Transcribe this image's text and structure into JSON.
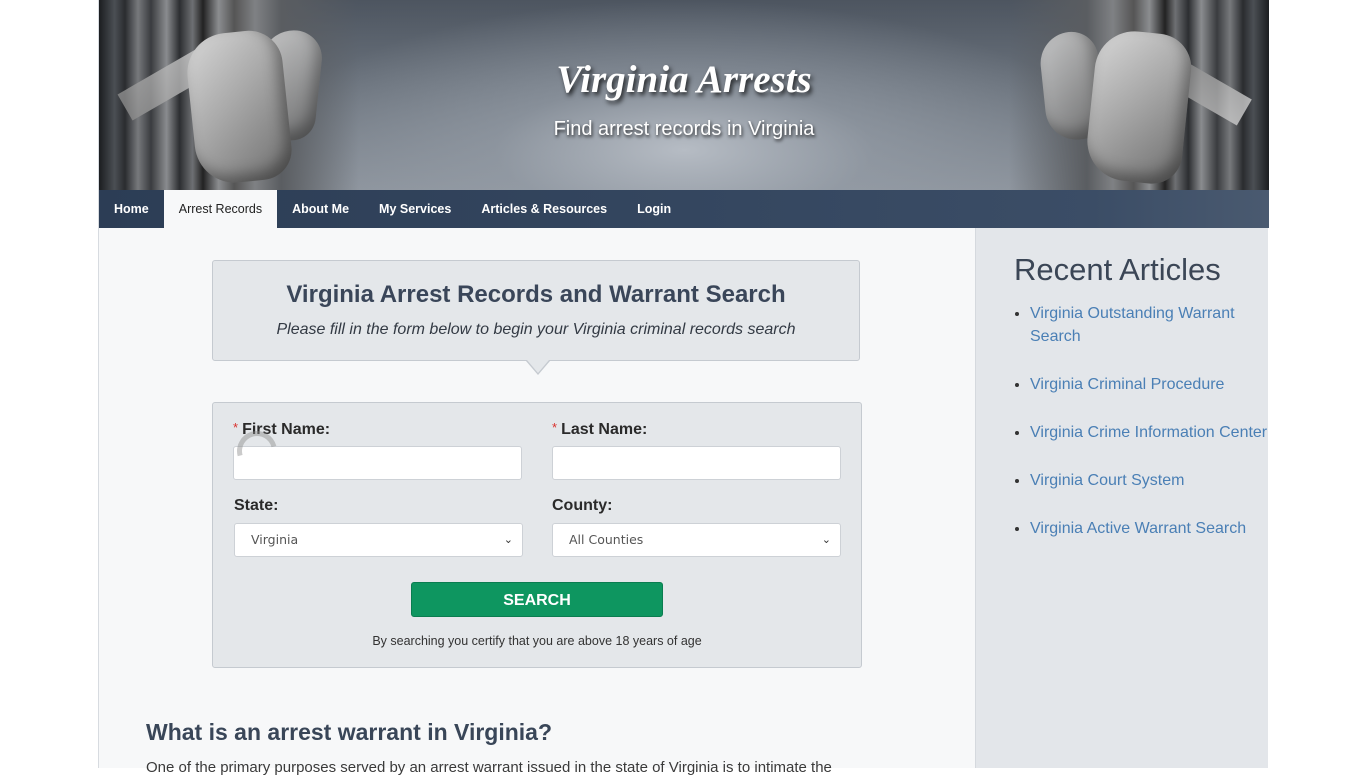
{
  "header": {
    "site_title": "Virginia Arrests",
    "tagline": "Find arrest records in Virginia"
  },
  "nav": {
    "items": [
      {
        "label": "Home",
        "active": false
      },
      {
        "label": "Arrest Records",
        "active": true
      },
      {
        "label": "About Me",
        "active": false
      },
      {
        "label": "My Services",
        "active": false
      },
      {
        "label": "Articles & Resources",
        "active": false
      },
      {
        "label": "Login",
        "active": false
      }
    ]
  },
  "search_intro": {
    "title": "Virginia Arrest Records and Warrant Search",
    "subtitle": "Please fill in the form below to begin your Virginia criminal records search"
  },
  "form": {
    "required_marker": "*",
    "first_name": {
      "label": "First Name:",
      "value": "",
      "placeholder": ""
    },
    "last_name": {
      "label": "Last Name:",
      "value": "",
      "placeholder": ""
    },
    "state": {
      "label": "State:",
      "selected": "Virginia"
    },
    "county": {
      "label": "County:",
      "selected": "All Counties"
    },
    "search_button": "SEARCH",
    "disclaimer": "By searching you certify that you are above 18 years of age"
  },
  "article": {
    "heading": "What is an arrest warrant in Virginia?",
    "first_line": "One of the primary purposes served by an arrest warrant issued in the state of Virginia is to intimate the"
  },
  "sidebar": {
    "heading": "Recent Articles",
    "links": [
      "Virginia Outstanding Warrant Search",
      "Virginia Criminal Procedure",
      "Virginia Crime Information Center",
      "Virginia Court System",
      "Virginia Active Warrant Search"
    ]
  },
  "colors": {
    "nav_bg": "#34465f",
    "search_button": "#0e9660",
    "link": "#4a7fb5",
    "required": "#d9302c",
    "heading": "#3a4659"
  }
}
